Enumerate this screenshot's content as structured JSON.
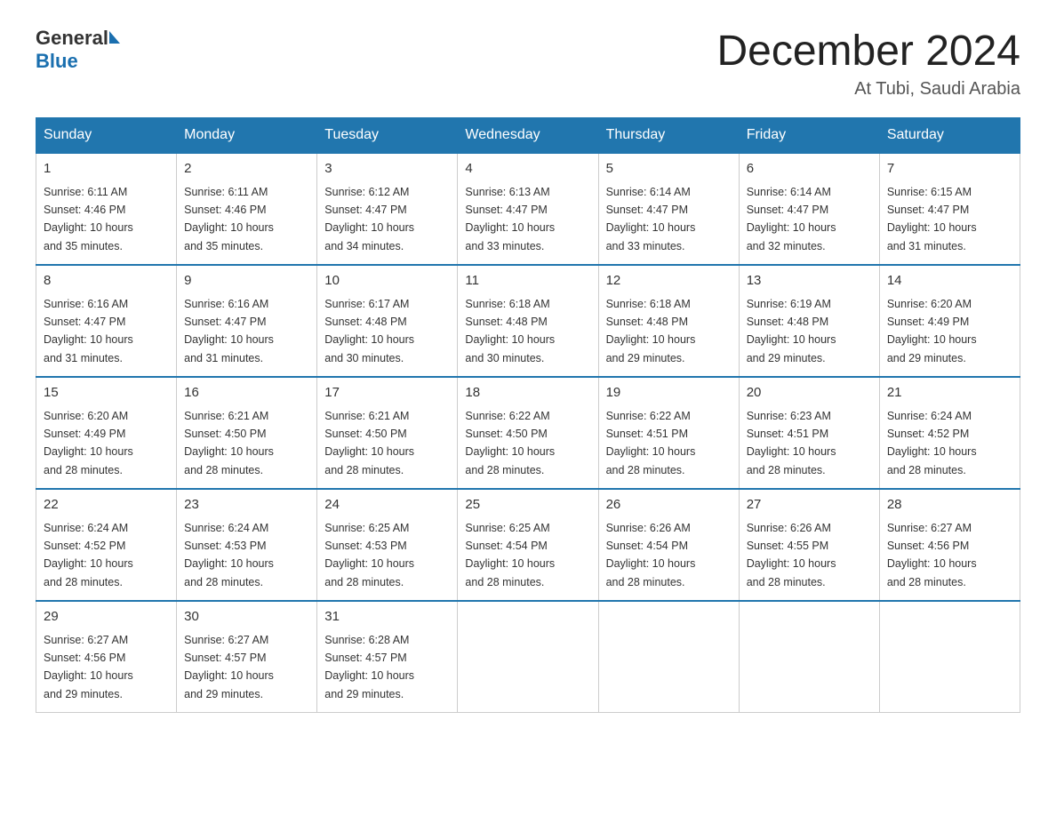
{
  "header": {
    "logo_general": "General",
    "logo_blue": "Blue",
    "month_title": "December 2024",
    "location": "At Tubi, Saudi Arabia"
  },
  "weekdays": [
    "Sunday",
    "Monday",
    "Tuesday",
    "Wednesday",
    "Thursday",
    "Friday",
    "Saturday"
  ],
  "weeks": [
    [
      {
        "day": "1",
        "sunrise": "6:11 AM",
        "sunset": "4:46 PM",
        "daylight": "10 hours and 35 minutes."
      },
      {
        "day": "2",
        "sunrise": "6:11 AM",
        "sunset": "4:46 PM",
        "daylight": "10 hours and 35 minutes."
      },
      {
        "day": "3",
        "sunrise": "6:12 AM",
        "sunset": "4:47 PM",
        "daylight": "10 hours and 34 minutes."
      },
      {
        "day": "4",
        "sunrise": "6:13 AM",
        "sunset": "4:47 PM",
        "daylight": "10 hours and 33 minutes."
      },
      {
        "day": "5",
        "sunrise": "6:14 AM",
        "sunset": "4:47 PM",
        "daylight": "10 hours and 33 minutes."
      },
      {
        "day": "6",
        "sunrise": "6:14 AM",
        "sunset": "4:47 PM",
        "daylight": "10 hours and 32 minutes."
      },
      {
        "day": "7",
        "sunrise": "6:15 AM",
        "sunset": "4:47 PM",
        "daylight": "10 hours and 31 minutes."
      }
    ],
    [
      {
        "day": "8",
        "sunrise": "6:16 AM",
        "sunset": "4:47 PM",
        "daylight": "10 hours and 31 minutes."
      },
      {
        "day": "9",
        "sunrise": "6:16 AM",
        "sunset": "4:47 PM",
        "daylight": "10 hours and 31 minutes."
      },
      {
        "day": "10",
        "sunrise": "6:17 AM",
        "sunset": "4:48 PM",
        "daylight": "10 hours and 30 minutes."
      },
      {
        "day": "11",
        "sunrise": "6:18 AM",
        "sunset": "4:48 PM",
        "daylight": "10 hours and 30 minutes."
      },
      {
        "day": "12",
        "sunrise": "6:18 AM",
        "sunset": "4:48 PM",
        "daylight": "10 hours and 29 minutes."
      },
      {
        "day": "13",
        "sunrise": "6:19 AM",
        "sunset": "4:48 PM",
        "daylight": "10 hours and 29 minutes."
      },
      {
        "day": "14",
        "sunrise": "6:20 AM",
        "sunset": "4:49 PM",
        "daylight": "10 hours and 29 minutes."
      }
    ],
    [
      {
        "day": "15",
        "sunrise": "6:20 AM",
        "sunset": "4:49 PM",
        "daylight": "10 hours and 28 minutes."
      },
      {
        "day": "16",
        "sunrise": "6:21 AM",
        "sunset": "4:50 PM",
        "daylight": "10 hours and 28 minutes."
      },
      {
        "day": "17",
        "sunrise": "6:21 AM",
        "sunset": "4:50 PM",
        "daylight": "10 hours and 28 minutes."
      },
      {
        "day": "18",
        "sunrise": "6:22 AM",
        "sunset": "4:50 PM",
        "daylight": "10 hours and 28 minutes."
      },
      {
        "day": "19",
        "sunrise": "6:22 AM",
        "sunset": "4:51 PM",
        "daylight": "10 hours and 28 minutes."
      },
      {
        "day": "20",
        "sunrise": "6:23 AM",
        "sunset": "4:51 PM",
        "daylight": "10 hours and 28 minutes."
      },
      {
        "day": "21",
        "sunrise": "6:24 AM",
        "sunset": "4:52 PM",
        "daylight": "10 hours and 28 minutes."
      }
    ],
    [
      {
        "day": "22",
        "sunrise": "6:24 AM",
        "sunset": "4:52 PM",
        "daylight": "10 hours and 28 minutes."
      },
      {
        "day": "23",
        "sunrise": "6:24 AM",
        "sunset": "4:53 PM",
        "daylight": "10 hours and 28 minutes."
      },
      {
        "day": "24",
        "sunrise": "6:25 AM",
        "sunset": "4:53 PM",
        "daylight": "10 hours and 28 minutes."
      },
      {
        "day": "25",
        "sunrise": "6:25 AM",
        "sunset": "4:54 PM",
        "daylight": "10 hours and 28 minutes."
      },
      {
        "day": "26",
        "sunrise": "6:26 AM",
        "sunset": "4:54 PM",
        "daylight": "10 hours and 28 minutes."
      },
      {
        "day": "27",
        "sunrise": "6:26 AM",
        "sunset": "4:55 PM",
        "daylight": "10 hours and 28 minutes."
      },
      {
        "day": "28",
        "sunrise": "6:27 AM",
        "sunset": "4:56 PM",
        "daylight": "10 hours and 28 minutes."
      }
    ],
    [
      {
        "day": "29",
        "sunrise": "6:27 AM",
        "sunset": "4:56 PM",
        "daylight": "10 hours and 29 minutes."
      },
      {
        "day": "30",
        "sunrise": "6:27 AM",
        "sunset": "4:57 PM",
        "daylight": "10 hours and 29 minutes."
      },
      {
        "day": "31",
        "sunrise": "6:28 AM",
        "sunset": "4:57 PM",
        "daylight": "10 hours and 29 minutes."
      },
      null,
      null,
      null,
      null
    ]
  ],
  "labels": {
    "sunrise": "Sunrise:",
    "sunset": "Sunset:",
    "daylight": "Daylight:"
  }
}
